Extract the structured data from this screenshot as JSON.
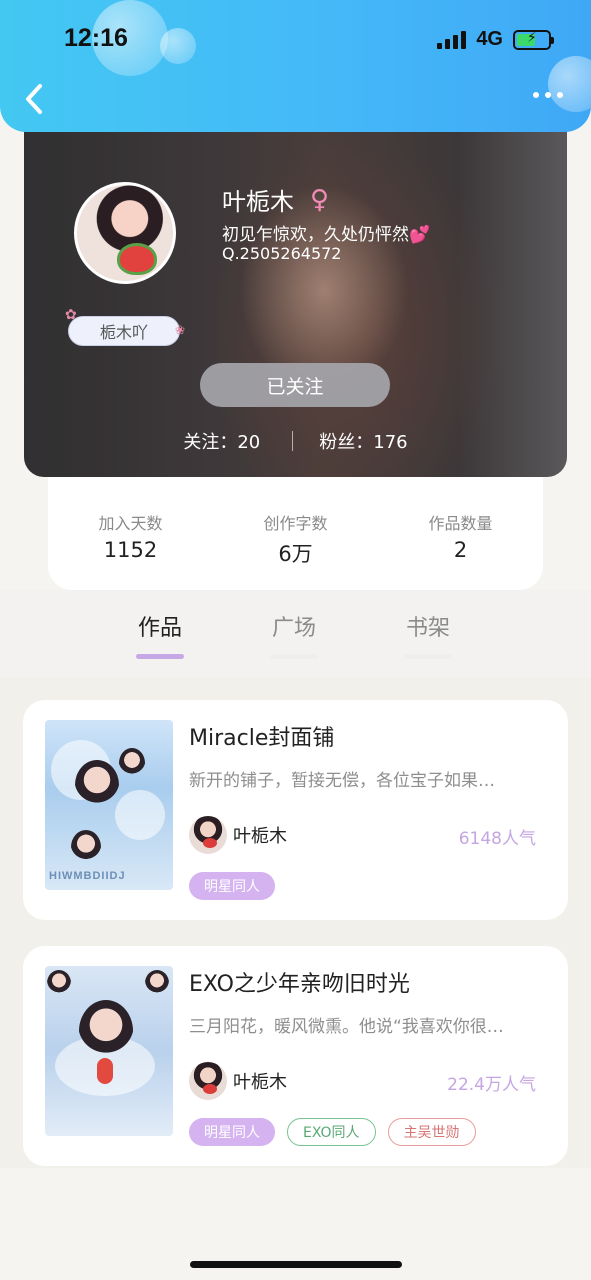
{
  "status_bar": {
    "time": "12:16",
    "network": "4G"
  },
  "profile": {
    "name": "叶栀木",
    "gender_symbol": "♀",
    "bio": "初见乍惊欢，久处仍怦然💕",
    "qq": "Q.2505264572",
    "nickname_tag": "栀木吖",
    "follow_label": "已关注",
    "following": "关注：20",
    "fans": "粉丝：176"
  },
  "stats": [
    {
      "label": "加入天数",
      "value": "1152"
    },
    {
      "label": "创作字数",
      "value": "6万"
    },
    {
      "label": "作品数量",
      "value": "2"
    }
  ],
  "tabs": [
    {
      "label": "作品",
      "active": true
    },
    {
      "label": "广场",
      "active": false
    },
    {
      "label": "书架",
      "active": false
    }
  ],
  "books": [
    {
      "title": "Miracle封面铺",
      "description": "新开的铺子，暂接无偿，各位宝子如果…",
      "author": "叶栀木",
      "popularity": "6148人气",
      "cover_text": "HIWMBDIIDJ",
      "tags": [
        {
          "label": "明星同人",
          "style": "fill"
        }
      ]
    },
    {
      "title": "EXO之少年亲吻旧时光",
      "description": "三月阳花，暖风微熏。他说“我喜欢你很…",
      "author": "叶栀木",
      "popularity": "22.4万人气",
      "tags": [
        {
          "label": "明星同人",
          "style": "fill"
        },
        {
          "label": "EXO同人",
          "style": "green"
        },
        {
          "label": "主吴世勋",
          "style": "red"
        }
      ]
    }
  ]
}
